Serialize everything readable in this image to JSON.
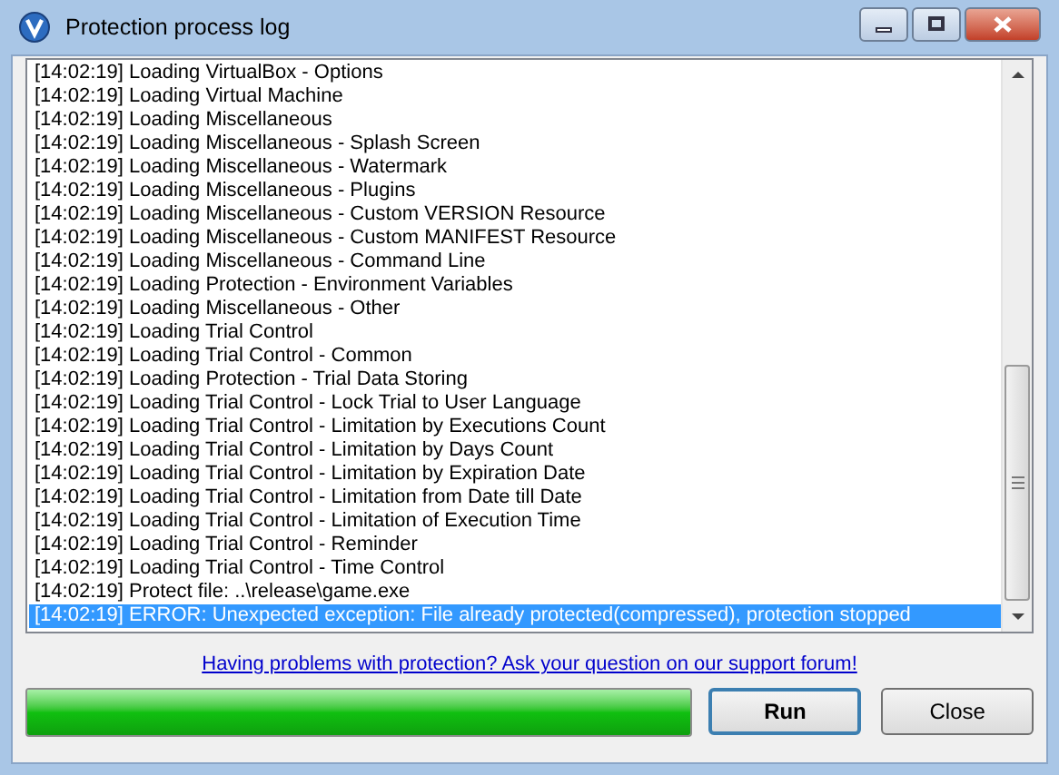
{
  "window": {
    "title": "Protection process log"
  },
  "log": {
    "rows": [
      {
        "text": "[14:02:19] Loading VirtualBox - Options",
        "selected": false
      },
      {
        "text": "[14:02:19] Loading Virtual Machine",
        "selected": false
      },
      {
        "text": "[14:02:19] Loading Miscellaneous",
        "selected": false
      },
      {
        "text": "[14:02:19] Loading Miscellaneous - Splash Screen",
        "selected": false
      },
      {
        "text": "[14:02:19] Loading Miscellaneous - Watermark",
        "selected": false
      },
      {
        "text": "[14:02:19] Loading Miscellaneous - Plugins",
        "selected": false
      },
      {
        "text": "[14:02:19] Loading Miscellaneous - Custom VERSION Resource",
        "selected": false
      },
      {
        "text": "[14:02:19] Loading Miscellaneous - Custom MANIFEST Resource",
        "selected": false
      },
      {
        "text": "[14:02:19] Loading Miscellaneous - Command Line",
        "selected": false
      },
      {
        "text": "[14:02:19] Loading Protection - Environment Variables",
        "selected": false
      },
      {
        "text": "[14:02:19] Loading Miscellaneous - Other",
        "selected": false
      },
      {
        "text": "[14:02:19] Loading Trial Control",
        "selected": false
      },
      {
        "text": "[14:02:19] Loading Trial Control - Common",
        "selected": false
      },
      {
        "text": "[14:02:19] Loading Protection - Trial Data Storing",
        "selected": false
      },
      {
        "text": "[14:02:19] Loading Trial Control - Lock Trial to User Language",
        "selected": false
      },
      {
        "text": "[14:02:19] Loading Trial Control - Limitation by Executions Count",
        "selected": false
      },
      {
        "text": "[14:02:19] Loading Trial Control - Limitation by Days Count",
        "selected": false
      },
      {
        "text": "[14:02:19] Loading Trial Control - Limitation by Expiration Date",
        "selected": false
      },
      {
        "text": "[14:02:19] Loading Trial Control - Limitation from Date till Date",
        "selected": false
      },
      {
        "text": "[14:02:19] Loading Trial Control - Limitation of Execution Time",
        "selected": false
      },
      {
        "text": "[14:02:19] Loading Trial Control - Reminder",
        "selected": false
      },
      {
        "text": "[14:02:19] Loading Trial Control - Time Control",
        "selected": false
      },
      {
        "text": "[14:02:19] Protect file: ..\\release\\game.exe",
        "selected": false
      },
      {
        "text": "[14:02:19] ERROR: Unexpected exception: File already protected(compressed), protection stopped",
        "selected": true
      }
    ]
  },
  "support_link": "Having problems with protection? Ask your question on our support forum!",
  "progress": {
    "level": 1
  },
  "buttons": [
    {
      "label": "Run",
      "default": true
    },
    {
      "label": "Close",
      "default": false
    }
  ]
}
